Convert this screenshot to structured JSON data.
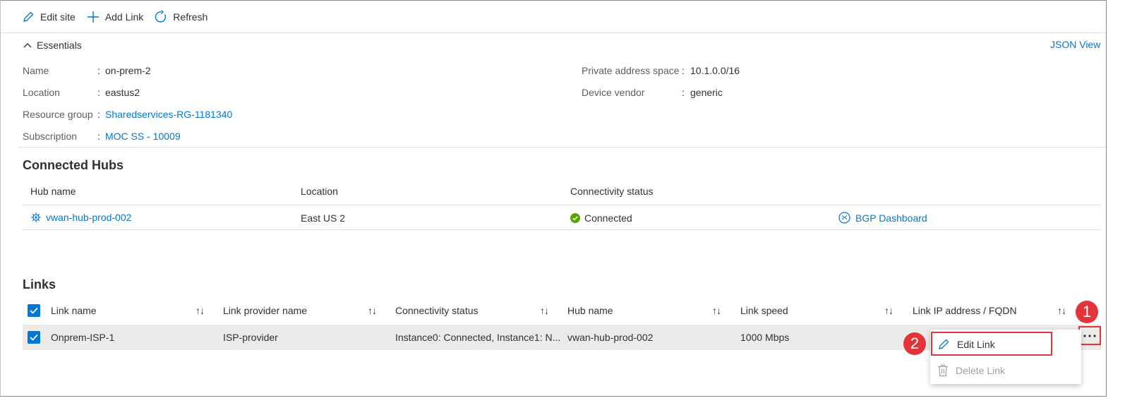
{
  "toolbar": {
    "edit_site": "Edit site",
    "add_link": "Add Link",
    "refresh": "Refresh"
  },
  "essentials": {
    "title": "Essentials",
    "json_view": "JSON View",
    "left": [
      {
        "label": "Name",
        "value": "on-prem-2"
      },
      {
        "label": "Location",
        "value": "eastus2"
      },
      {
        "label": "Resource group",
        "value": "Sharedservices-RG-1181340"
      },
      {
        "label": "Subscription",
        "value": "MOC SS - 10009"
      }
    ],
    "right": [
      {
        "label": "Private address space",
        "value": "10.1.0.0/16"
      },
      {
        "label": "Device vendor",
        "value": "generic"
      }
    ],
    "separator": ":"
  },
  "connected_hubs": {
    "title": "Connected Hubs",
    "columns": [
      "Hub name",
      "Location",
      "Connectivity status"
    ],
    "row": {
      "hub_name": "vwan-hub-prod-002",
      "location": "East US 2",
      "status": "Connected",
      "bgp": "BGP Dashboard"
    }
  },
  "links": {
    "title": "Links",
    "columns": [
      "Link name",
      "Link provider name",
      "Connectivity status",
      "Hub name",
      "Link speed",
      "Link IP address / FQDN"
    ],
    "sort_glyph": "↑↓",
    "row": {
      "link_name": "Onprem-ISP-1",
      "provider": "ISP-provider",
      "status": "Instance0: Connected, Instance1: N...",
      "hub_name": "vwan-hub-prod-002",
      "speed": "1000 Mbps"
    }
  },
  "context_menu": {
    "edit": "Edit Link",
    "delete": "Delete Link"
  },
  "callouts": {
    "one": "1",
    "two": "2"
  },
  "colors": {
    "accent": "#0078d4",
    "success": "#57a300",
    "callout": "#e3343a"
  }
}
